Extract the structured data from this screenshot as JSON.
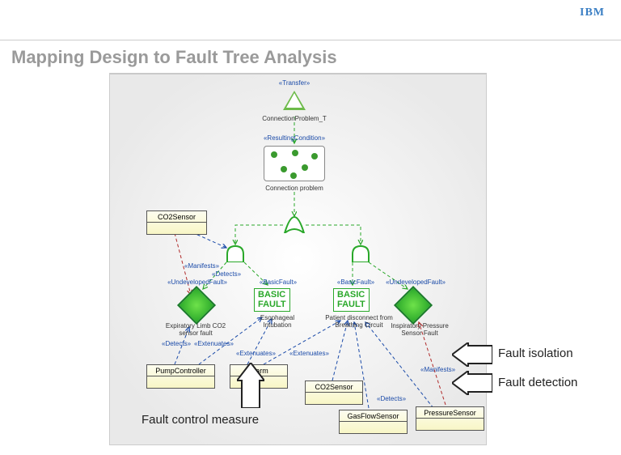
{
  "header": {
    "logo": "IBM"
  },
  "title": "Mapping Design to Fault Tree Analysis",
  "diagram": {
    "transfer": {
      "stereo": "«Transfer»",
      "label": "ConnectionProblem_T"
    },
    "resultingCondition": {
      "stereo": "«ResultingCondition»",
      "label": "Connection problem"
    },
    "leftBranch": {
      "undevFault": {
        "stereo": "«UndevelopedFault»",
        "label": "Expiratory Limb CO2 sensor fault"
      },
      "basicFault": {
        "stereo": "«BasicFault»",
        "boxLine1": "BASIC",
        "boxLine2": "FAULT",
        "label": "Esophageal Intubation"
      }
    },
    "rightBranch": {
      "basicFault": {
        "stereo": "«BasicFault»",
        "boxLine1": "BASIC",
        "boxLine2": "FAULT",
        "label": "Patient disconnect from Breathing Circuit"
      },
      "undevFault": {
        "stereo": "«UndevelopedFault»",
        "label": "Inspiratory Pressure Sensor Fault"
      }
    },
    "classes": {
      "co2sensor_top": "CO2Sensor",
      "pumpController": "PumpController",
      "alarm": "Alarm",
      "co2sensor_bottom": "CO2Sensor",
      "gasFlowSensor": "GasFlowSensor",
      "pressureSensor": "PressureSensor"
    },
    "edgeLabels": {
      "manifests": "«Manifests»",
      "detects": "«Detects»",
      "extenuates": "«Extenuates»"
    }
  },
  "callouts": {
    "faultIsolation": "Fault isolation",
    "faultDetection": "Fault detection",
    "faultControlMeasure": "Fault control measure"
  }
}
